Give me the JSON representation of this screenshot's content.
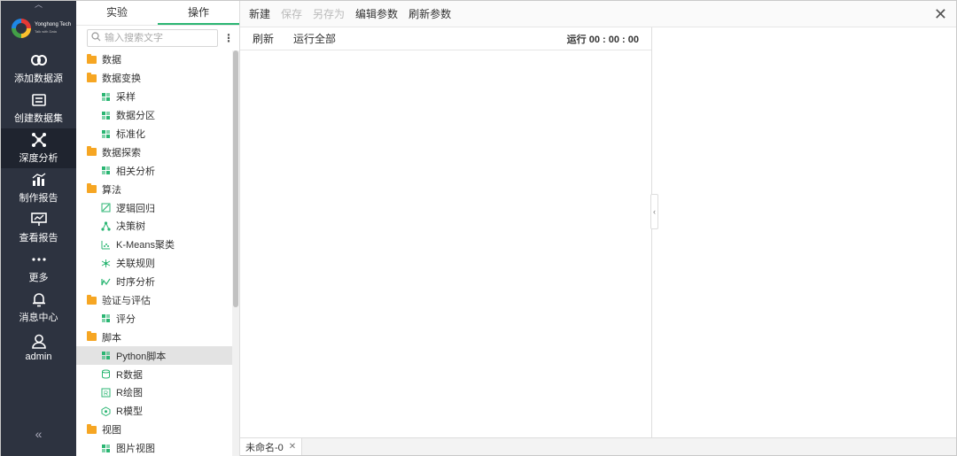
{
  "rail": {
    "brand_name": "Yonghong Tech",
    "brand_tagline": "Talk with Data",
    "items": [
      {
        "label": "添加数据源",
        "icon": "link-icon",
        "active": false
      },
      {
        "label": "创建数据集",
        "icon": "dataset-icon",
        "active": false
      },
      {
        "label": "深度分析",
        "icon": "deep-analysis-icon",
        "active": true
      },
      {
        "label": "制作报告",
        "icon": "chart-icon",
        "active": false
      },
      {
        "label": "查看报告",
        "icon": "presentation-icon",
        "active": false
      },
      {
        "label": "更多",
        "icon": "more-icon",
        "active": false
      },
      {
        "label": "消息中心",
        "icon": "bell-icon",
        "active": false
      },
      {
        "label": "admin",
        "icon": "user-icon",
        "active": false
      }
    ],
    "collapse_glyph": "«"
  },
  "panel": {
    "tabs": [
      {
        "label": "实验",
        "active": false
      },
      {
        "label": "操作",
        "active": true
      }
    ],
    "search": {
      "placeholder": "输入搜索文字"
    },
    "tree": [
      {
        "type": "folder",
        "label": "数据"
      },
      {
        "type": "folder",
        "label": "数据变换"
      },
      {
        "type": "leaf",
        "label": "采样",
        "icon": "sample-icon"
      },
      {
        "type": "leaf",
        "label": "数据分区",
        "icon": "partition-icon"
      },
      {
        "type": "leaf",
        "label": "标准化",
        "icon": "normalize-icon"
      },
      {
        "type": "folder",
        "label": "数据探索"
      },
      {
        "type": "leaf",
        "label": "相关分析",
        "icon": "correlation-icon"
      },
      {
        "type": "folder",
        "label": "算法"
      },
      {
        "type": "leaf",
        "label": "逻辑回归",
        "icon": "regression-icon"
      },
      {
        "type": "leaf",
        "label": "决策树",
        "icon": "tree-icon"
      },
      {
        "type": "leaf",
        "label": "K-Means聚类",
        "icon": "cluster-icon"
      },
      {
        "type": "leaf",
        "label": "关联规则",
        "icon": "association-icon"
      },
      {
        "type": "leaf",
        "label": "时序分析",
        "icon": "timeseries-icon"
      },
      {
        "type": "folder",
        "label": "验证与评估"
      },
      {
        "type": "leaf",
        "label": "评分",
        "icon": "score-icon"
      },
      {
        "type": "folder",
        "label": "脚本"
      },
      {
        "type": "leaf",
        "label": "Python脚本",
        "icon": "python-icon",
        "selected": true
      },
      {
        "type": "leaf",
        "label": "R数据",
        "icon": "r-data-icon"
      },
      {
        "type": "leaf",
        "label": "R绘图",
        "icon": "r-plot-icon"
      },
      {
        "type": "leaf",
        "label": "R模型",
        "icon": "r-model-icon"
      },
      {
        "type": "folder",
        "label": "视图"
      },
      {
        "type": "leaf",
        "label": "图片视图",
        "icon": "image-view-icon"
      }
    ]
  },
  "toolbar": {
    "new_label": "新建",
    "save_label": "保存",
    "save_as_label": "另存为",
    "edit_params_label": "编辑参数",
    "refresh_params_label": "刷新参数",
    "close_glyph": "✕"
  },
  "subbar": {
    "refresh_label": "刷新",
    "run_all_label": "运行全部",
    "runtime": "运行 00 : 00 : 00"
  },
  "splitter_glyph": "‹",
  "doc_tab": {
    "label": "未命名-0",
    "close_glyph": "✕"
  },
  "colors": {
    "rail_bg": "#2d3340",
    "accent": "#2bb673",
    "folder": "#f6a623"
  }
}
